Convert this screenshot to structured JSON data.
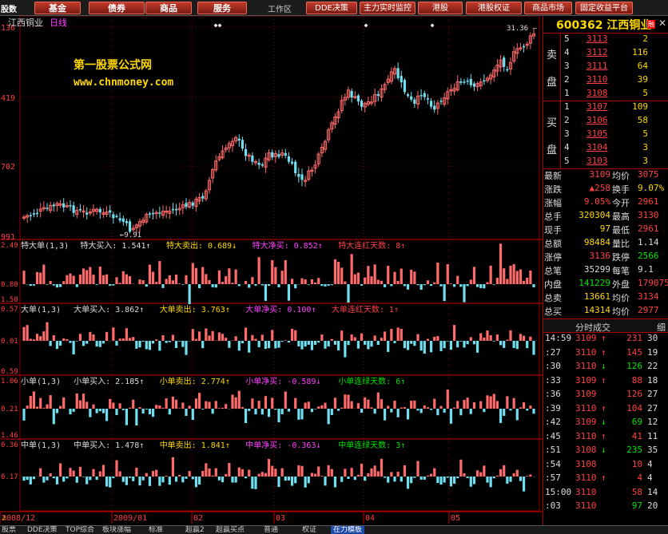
{
  "toolbar": {
    "left_fragment": "股数",
    "buttons": [
      "基金",
      "债券",
      "商品",
      "服务"
    ],
    "workspace": "工作区",
    "right_buttons": [
      "DDE决策",
      "主力实时监控",
      "港股",
      "港股权证",
      "商品市场",
      "固定收益平台"
    ]
  },
  "chart": {
    "stock_name": "江西铜业",
    "period": "日线",
    "watermark_title": "第一股票公式网",
    "watermark_url": "www.chnmoney.com",
    "high_label": "31.36",
    "low_label": "9.91",
    "y_labels": [
      "136",
      "419",
      "702",
      "991"
    ],
    "x_labels": [
      "2008/12",
      "2009/01",
      "02",
      "03",
      "04",
      "05"
    ],
    "colors": {
      "up": "#ff6a6a",
      "down": "#70e0f0",
      "grid": "#8b0000",
      "axis_text": "#ff4040"
    }
  },
  "indicators": [
    {
      "id": "super",
      "scale": [
        "2.49",
        "0.80",
        "1.50"
      ],
      "legend": [
        {
          "text": "特大单(1,3)",
          "color": "#dddddd"
        },
        {
          "text": "特大买入: 1.541↑",
          "color": "#dddddd"
        },
        {
          "text": "特大卖出: 0.689↓",
          "color": "#ffd800"
        },
        {
          "text": "特大净买: 0.852↑",
          "color": "#ff40ff"
        },
        {
          "text": "特大连红天数: 8↑",
          "color": "#ff4040"
        }
      ]
    },
    {
      "id": "large",
      "scale": [
        "0.57",
        "0.01",
        "0.59"
      ],
      "legend": [
        {
          "text": "大单(1,3)",
          "color": "#dddddd"
        },
        {
          "text": "大单买入: 3.862↑",
          "color": "#dddddd"
        },
        {
          "text": "大单卖出: 3.763↑",
          "color": "#ffd800"
        },
        {
          "text": "大单净买: 0.100↑",
          "color": "#ff40ff"
        },
        {
          "text": "大单连红天数: 1↑",
          "color": "#ff4040"
        }
      ]
    },
    {
      "id": "small",
      "scale": [
        "1.06",
        "0.21",
        "1.46"
      ],
      "legend": [
        {
          "text": "小单(1,3)",
          "color": "#dddddd"
        },
        {
          "text": "小单买入: 2.185↑",
          "color": "#dddddd"
        },
        {
          "text": "小单卖出: 2.774↑",
          "color": "#ffd800"
        },
        {
          "text": "小单净买: -0.589↓",
          "color": "#ff40ff"
        },
        {
          "text": "小单连绿天数: 6↑",
          "color": "#00e000"
        }
      ]
    },
    {
      "id": "medium",
      "scale": [
        "0.36",
        "0.17",
        ""
      ],
      "legend": [
        {
          "text": "中单(1,3)",
          "color": "#dddddd"
        },
        {
          "text": "中单买入: 1.478↑",
          "color": "#dddddd"
        },
        {
          "text": "中单卖出: 1.841↑",
          "color": "#ffd800"
        },
        {
          "text": "中单净买: -0.363↓",
          "color": "#ff40ff"
        },
        {
          "text": "中单连绿天数: 3↑",
          "color": "#00e000"
        }
      ]
    }
  ],
  "quote": {
    "code": "600362",
    "name": "江西铜业",
    "badge": "融",
    "sell_label_1": "卖",
    "sell_label_2": "盘",
    "buy_label_1": "买",
    "buy_label_2": "盘",
    "asks": [
      {
        "level": "5",
        "price": "3113",
        "volume": "2"
      },
      {
        "level": "4",
        "price": "3112",
        "volume": "116"
      },
      {
        "level": "3",
        "price": "3111",
        "volume": "64"
      },
      {
        "level": "2",
        "price": "3110",
        "volume": "39"
      },
      {
        "level": "1",
        "price": "3108",
        "volume": "5"
      }
    ],
    "bids": [
      {
        "level": "1",
        "price": "3107",
        "volume": "109"
      },
      {
        "level": "2",
        "price": "3106",
        "volume": "58"
      },
      {
        "level": "3",
        "price": "3105",
        "volume": "5"
      },
      {
        "level": "4",
        "price": "3104",
        "volume": "3"
      },
      {
        "level": "5",
        "price": "3103",
        "volume": "3"
      }
    ],
    "stats": [
      {
        "k1": "最新",
        "v1": "3109",
        "c1": "red",
        "k2": "均价",
        "v2": "3075",
        "c2": "red"
      },
      {
        "k1": "涨跌",
        "v1": "▲258",
        "c1": "red",
        "k2": "换手",
        "v2": "9.07%",
        "c2": "yel"
      },
      {
        "k1": "涨幅",
        "v1": "9.05%",
        "c1": "red",
        "k2": "今开",
        "v2": "2961",
        "c2": "red"
      },
      {
        "k1": "总手",
        "v1": "320304",
        "c1": "yel",
        "k2": "最高",
        "v2": "3130",
        "c2": "red"
      },
      {
        "k1": "现手",
        "v1": "97",
        "c1": "yel",
        "k2": "最低",
        "v2": "2961",
        "c2": "red"
      },
      {
        "k1": "总额",
        "v1": "98484",
        "c1": "yel",
        "k2": "量比",
        "v2": "1.14",
        "c2": "wht"
      },
      {
        "k1": "涨停",
        "v1": "3136",
        "c1": "red",
        "k2": "跌停",
        "v2": "2566",
        "c2": "grn"
      },
      {
        "k1": "总笔",
        "v1": "35299",
        "c1": "wht",
        "k2": "每笔",
        "v2": "9.1",
        "c2": "wht"
      },
      {
        "k1": "内盘",
        "v1": "141229",
        "c1": "grn",
        "k2": "外盘",
        "v2": "179075",
        "c2": "red"
      },
      {
        "k1": "总卖",
        "v1": "13661",
        "c1": "yel",
        "k2": "均价",
        "v2": "3134",
        "c2": "red"
      },
      {
        "k1": "总买",
        "v1": "14314",
        "c1": "yel",
        "k2": "均价",
        "v2": "2977",
        "c2": "red"
      }
    ],
    "ticks_title": "分时成交",
    "ticks_btn": "细",
    "ticks": [
      {
        "time": "14:59",
        "price": "3109",
        "dir": "↑",
        "vol": "231",
        "n": "30",
        "vc": "red"
      },
      {
        "time": ":27",
        "price": "3110",
        "dir": "↑",
        "vol": "145",
        "n": "19",
        "vc": "red"
      },
      {
        "time": ":30",
        "price": "3110",
        "dir": "↓",
        "vol": "126",
        "n": "22",
        "vc": "grn"
      },
      {
        "time": ":33",
        "price": "3109",
        "dir": "↑",
        "vol": "88",
        "n": "18",
        "vc": "red"
      },
      {
        "time": ":36",
        "price": "3109",
        "dir": "",
        "vol": "126",
        "n": "27",
        "vc": "red"
      },
      {
        "time": ":39",
        "price": "3110",
        "dir": "↑",
        "vol": "104",
        "n": "27",
        "vc": "red"
      },
      {
        "time": ":42",
        "price": "3109",
        "dir": "↓",
        "vol": "69",
        "n": "12",
        "vc": "grn"
      },
      {
        "time": ":45",
        "price": "3110",
        "dir": "↑",
        "vol": "41",
        "n": "11",
        "vc": "red"
      },
      {
        "time": ":51",
        "price": "3108",
        "dir": "↓",
        "vol": "235",
        "n": "35",
        "vc": "grn"
      },
      {
        "time": ":54",
        "price": "3108",
        "dir": "",
        "vol": "10",
        "n": "4",
        "vc": "red"
      },
      {
        "time": ":57",
        "price": "3110",
        "dir": "↑",
        "vol": "4",
        "n": "4",
        "vc": "red"
      },
      {
        "time": "15:00",
        "price": "3110",
        "dir": "",
        "vol": "58",
        "n": "14",
        "vc": "red"
      },
      {
        "time": ":03",
        "price": "3110",
        "dir": "",
        "vol": "97",
        "n": "20",
        "vc": "grn"
      }
    ]
  },
  "bottombar": [
    "股票",
    "DDE决策",
    "TOP综合",
    "板块涨幅",
    "标准",
    "超赢2",
    "超赢买点",
    "普通",
    "权证",
    "在力模板"
  ]
}
